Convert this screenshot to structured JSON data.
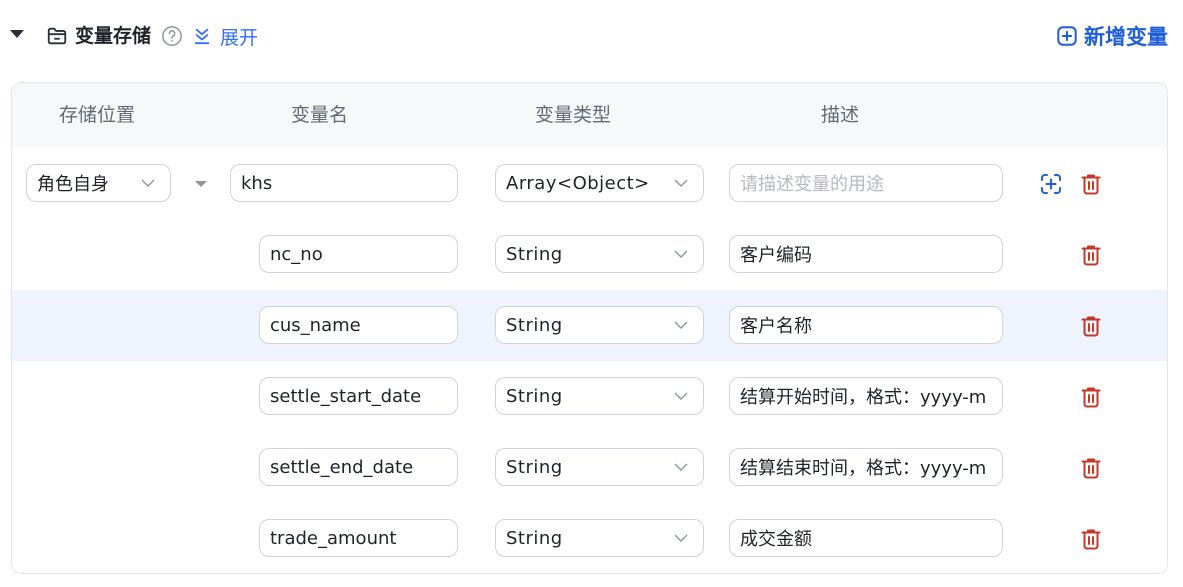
{
  "header": {
    "title": "变量存储",
    "expand_label": "展开",
    "add_button_label": "新增变量"
  },
  "table": {
    "columns": [
      "存储位置",
      "变量名",
      "变量类型",
      "描述"
    ],
    "rows": [
      {
        "storage": "角色自身",
        "name": "khs",
        "type": "Array<Object>",
        "description": "",
        "description_placeholder": "请描述变量的用途",
        "level": 0
      },
      {
        "name": "nc_no",
        "type": "String",
        "description": "客户编码",
        "level": 1
      },
      {
        "name": "cus_name",
        "type": "String",
        "description": "客户名称",
        "level": 1,
        "highlighted": true
      },
      {
        "name": "settle_start_date",
        "type": "String",
        "description": "结算开始时间，格式：yyyy-m",
        "level": 1
      },
      {
        "name": "settle_end_date",
        "type": "String",
        "description": "结算结束时间，格式：yyyy-m",
        "level": 1
      },
      {
        "name": "trade_amount",
        "type": "String",
        "description": "成交金额",
        "level": 1
      }
    ]
  },
  "colors": {
    "accent": "#3370ff",
    "danger": "#c0392b",
    "header_bg": "#f7f8fa",
    "row_highlight": "#eef3fd"
  },
  "icons": [
    "folder-icon",
    "help-icon",
    "expand-icon",
    "add-square-icon",
    "add-child-icon",
    "trash-icon",
    "chevron-down-icon",
    "caret-down-icon"
  ]
}
